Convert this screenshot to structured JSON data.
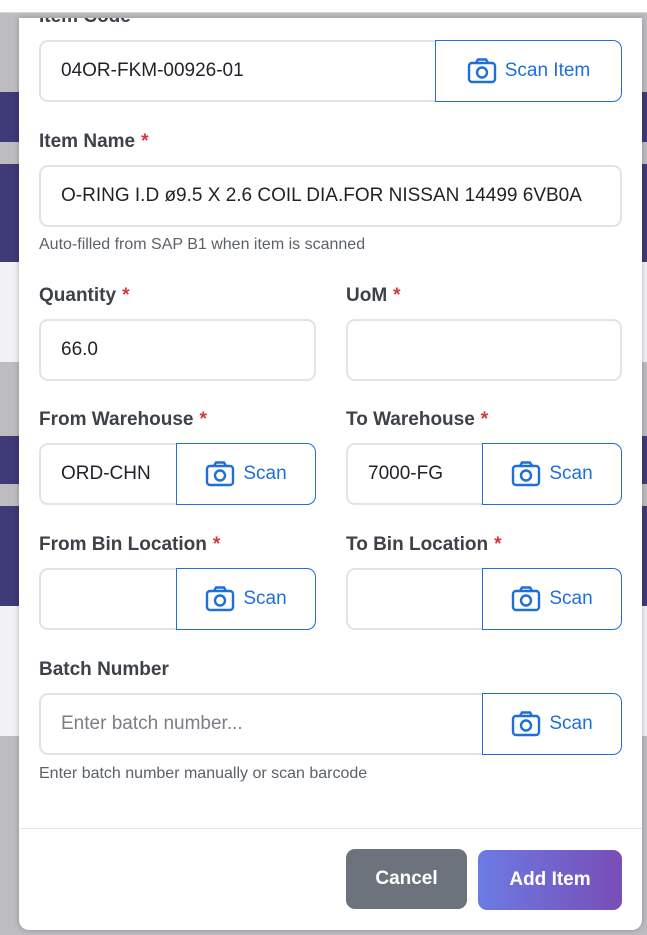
{
  "form": {
    "item_code": {
      "label": "Item Code",
      "value": "04OR-FKM-00926-01",
      "scan_label": "Scan Item"
    },
    "item_name": {
      "label": "Item Name",
      "required_mark": "*",
      "value": "O-RING I.D ø9.5 X 2.6 COIL DIA.FOR NISSAN 14499 6VB0A",
      "help": "Auto-filled from SAP B1 when item is scanned"
    },
    "quantity": {
      "label": "Quantity",
      "required_mark": "*",
      "value": "66.0"
    },
    "uom": {
      "label": "UoM",
      "required_mark": "*",
      "value": ""
    },
    "from_warehouse": {
      "label": "From Warehouse",
      "required_mark": "*",
      "value": "ORD-CHN",
      "scan_label": "Scan"
    },
    "to_warehouse": {
      "label": "To Warehouse",
      "required_mark": "*",
      "value": "7000-FG",
      "scan_label": "Scan"
    },
    "from_bin": {
      "label": "From Bin Location",
      "required_mark": "*",
      "value": "",
      "scan_label": "Scan"
    },
    "to_bin": {
      "label": "To Bin Location",
      "required_mark": "*",
      "value": "",
      "scan_label": "Scan"
    },
    "batch": {
      "label": "Batch Number",
      "placeholder": "Enter batch number...",
      "scan_label": "Scan",
      "help": "Enter batch number manually or scan barcode"
    }
  },
  "footer": {
    "cancel_label": "Cancel",
    "add_label": "Add Item"
  },
  "colors": {
    "accent": "#1e6fd9",
    "required": "#d9353c",
    "cancel_bg": "#6c737c",
    "add_gradient_start": "#6b7be3",
    "add_gradient_end": "#7a4db6"
  },
  "icons": {
    "scan": "camera-icon"
  }
}
